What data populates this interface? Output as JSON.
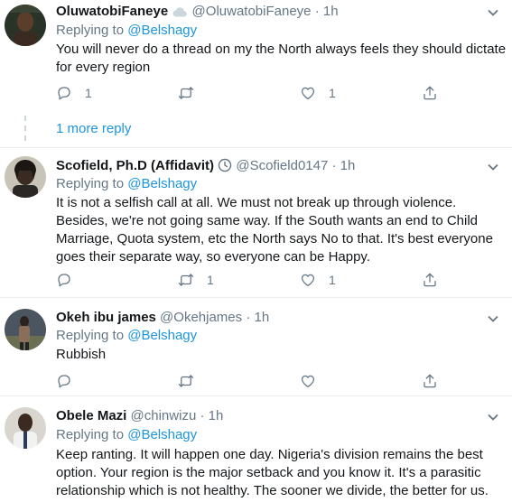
{
  "tweets": [
    {
      "name": "OluwatobiFaneye",
      "handle": "@OluwatobiFaneye",
      "dot": "·",
      "time": "1h",
      "replying_prefix": "Replying to ",
      "mention": "@Belshagy",
      "text": "You will never do a thread on my the North always feels they should dictate for every region",
      "reply_count": "1",
      "retweet_count": "",
      "like_count": "1"
    },
    {
      "name": "Scofield, Ph.D (Affidavit)",
      "handle": "@Scofield0147",
      "dot": "·",
      "time": "1h",
      "replying_prefix": "Replying to ",
      "mention": "@Belshagy",
      "text": "It is not a selfish call at all. We must not break up through violence. Besides, we're not going same way. If the South wants an end to Child Marriage, Quota system, etc the North says No to that. It's best everyone goes their separate way, so everyone can be Happy.",
      "reply_count": "",
      "retweet_count": "1",
      "like_count": "1"
    },
    {
      "name": "Okeh ibu james",
      "handle": "@Okehjames",
      "dot": "·",
      "time": "1h",
      "replying_prefix": "Replying to ",
      "mention": "@Belshagy",
      "text": "Rubbish",
      "reply_count": "",
      "retweet_count": "",
      "like_count": ""
    },
    {
      "name": "Obele Mazi",
      "handle": "@chinwizu",
      "dot": "·",
      "time": "1h",
      "replying_prefix": "Replying to ",
      "mention": "@Belshagy",
      "text": "Keep ranting. It will happen one day. Nigeria's division remains the best option. Your region is the major setback and you know it. It's a parasitic relationship which is not healthy. The sooner we divide, the better for us."
    }
  ],
  "more_reply": "1 more reply",
  "icons": {
    "reply": "reply-icon",
    "retweet": "retweet-icon",
    "like": "heart-icon",
    "share": "share-icon",
    "menu": "chevron-down-icon"
  },
  "colors": {
    "link": "#1b95e0",
    "muted": "#657786",
    "text": "#14171a",
    "divider": "#e6ecf0"
  }
}
